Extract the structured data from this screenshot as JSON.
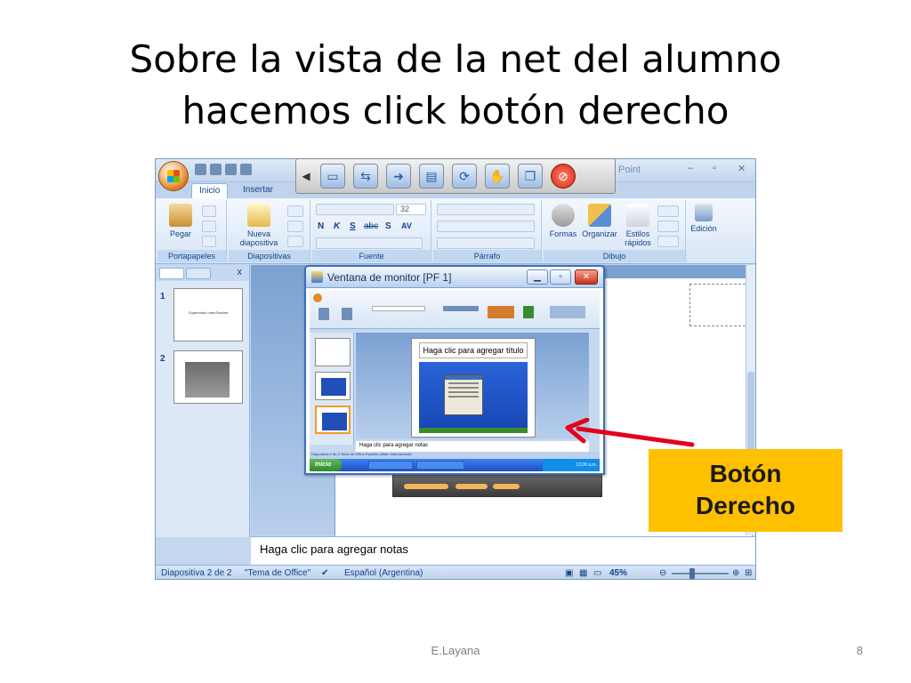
{
  "slide": {
    "title_line1": "Sobre la vista de la net del alumno",
    "title_line2": "hacemos click botón derecho",
    "footer_author": "E.Layana",
    "footer_page": "8"
  },
  "callout": {
    "line1": "Botón",
    "line2": "Derecho",
    "color": "#ffc000"
  },
  "powerpoint": {
    "app_name_fragment": "Point",
    "window_controls": [
      "–",
      "▫",
      "✕"
    ],
    "tabs": [
      "Inicio",
      "Insertar"
    ],
    "ribbon_groups": {
      "portapapeles": "Portapapeles",
      "diapositivas": "Diapositivas",
      "fuente": "Fuente",
      "parrafo": "Párrafo",
      "dibujo": "Dibujo"
    },
    "ribbon_buttons": {
      "pegar": "Pegar",
      "nueva_diapositiva": "Nueva diapositiva",
      "formas": "Formas",
      "organizar": "Organizar",
      "estilos_rapidos": "Estilos rápidos",
      "edicion": "Edición"
    },
    "font_size": "32",
    "font_buttons": [
      "N",
      "K",
      "S",
      "abc",
      "S",
      "AV"
    ],
    "slide_numbers": [
      "1",
      "2"
    ],
    "thumb1_text": "Supervisar LearnTeacher",
    "pane_close": "x",
    "notes_placeholder": "Haga clic para agregar notas",
    "status": {
      "slide_of": "Diapositiva 2 de 2",
      "theme": "\"Tema de Office\"",
      "language": "Español (Argentina)",
      "zoom": "45%"
    }
  },
  "floating_toolbar": {
    "icons": [
      "back-arrow-icon",
      "monitor-icon",
      "two-screens-icon",
      "screens-swap-icon",
      "forward-arrow-icon",
      "document-icon",
      "refresh-icon",
      "hand-icon",
      "copy-screens-icon",
      "stop-icon"
    ]
  },
  "monitor_window": {
    "title": "Ventana de monitor [PF 1]",
    "controls": [
      "▁",
      "▫",
      "✕"
    ],
    "slide_title_placeholder": "Haga clic para agregar título",
    "notes_placeholder": "Haga clic para agregar notas",
    "status_text": "Diapositiva 2 de 2    Tema de Office    Español (alfab. internacional)",
    "start_label": "Inicio",
    "tray_time": "13:06 a.m."
  },
  "colors": {
    "ribbon_blue": "#c5d7ee",
    "arrow_red": "#e3001b",
    "callout_yellow": "#ffc000"
  }
}
